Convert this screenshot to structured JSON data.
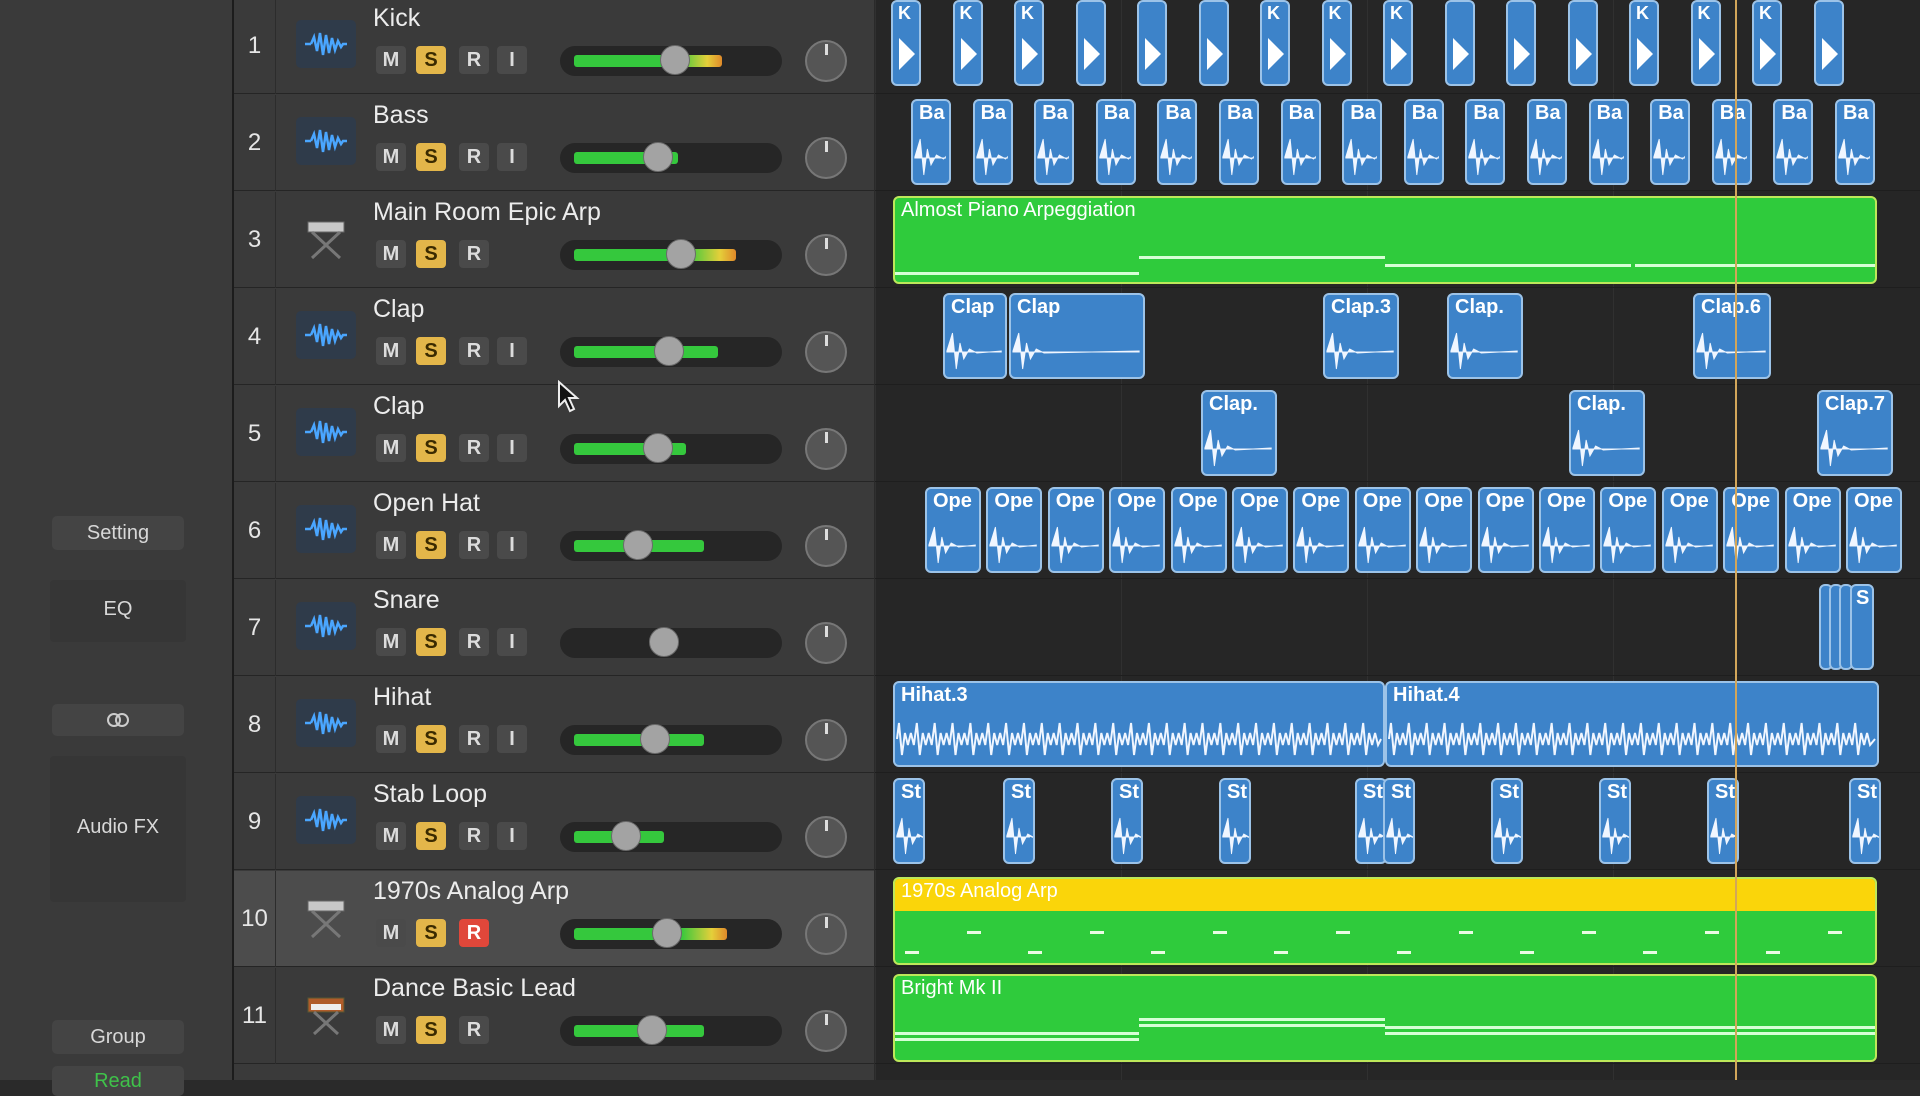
{
  "inspector": {
    "setting_label": "Setting",
    "eq_label": "EQ",
    "link_icon": "link-icon",
    "audio_fx_label": "Audio FX",
    "group_label": "Group",
    "read_label": "Read"
  },
  "track_buttons": {
    "mute": "M",
    "solo": "S",
    "record": "R",
    "input": "I"
  },
  "tracks": [
    {
      "num": "1",
      "name": "Kick",
      "type": "audio",
      "fader_level": 0.52,
      "meter": 0.82,
      "has_input": true
    },
    {
      "num": "2",
      "name": "Bass",
      "type": "audio",
      "fader_level": 0.42,
      "meter": 0.58,
      "has_input": true
    },
    {
      "num": "3",
      "name": "Main Room Epic Arp",
      "type": "instrument",
      "fader_level": 0.55,
      "meter": 0.9,
      "has_input": false
    },
    {
      "num": "4",
      "name": "Clap",
      "type": "audio",
      "fader_level": 0.48,
      "meter": 0.8,
      "has_input": true
    },
    {
      "num": "5",
      "name": "Clap",
      "type": "audio",
      "fader_level": 0.42,
      "meter": 0.62,
      "has_input": true
    },
    {
      "num": "6",
      "name": "Open Hat",
      "type": "audio",
      "fader_level": 0.3,
      "meter": 0.72,
      "has_input": true
    },
    {
      "num": "7",
      "name": "Snare",
      "type": "audio",
      "fader_level": 0.45,
      "meter": 0.0,
      "has_input": true
    },
    {
      "num": "8",
      "name": "Hihat",
      "type": "audio",
      "fader_level": 0.4,
      "meter": 0.72,
      "has_input": true
    },
    {
      "num": "9",
      "name": "Stab Loop",
      "type": "audio",
      "fader_level": 0.23,
      "meter": 0.5,
      "has_input": true
    },
    {
      "num": "10",
      "name": "1970s Analog Arp",
      "type": "instrument",
      "fader_level": 0.47,
      "meter": 0.85,
      "has_input": false,
      "selected": true,
      "record_armed": true
    },
    {
      "num": "11",
      "name": "Dance Basic Lead",
      "type": "keyboard",
      "fader_level": 0.38,
      "meter": 0.72,
      "has_input": false
    }
  ],
  "regions": {
    "kick_label": "K",
    "bass_label": "Ba",
    "arp_name": "Almost Piano Arpeggiation",
    "clap_a": [
      "Clap",
      "Clap",
      "Clap.3",
      "Clap.",
      "Clap.6"
    ],
    "clap_b": [
      "Clap.",
      "Clap.",
      "Clap.7"
    ],
    "open_hat_label": "Ope",
    "snare_label": "S",
    "hihat": [
      "Hihat.3",
      "Hihat.4"
    ],
    "stab_label": "St",
    "analog_arp_name": "1970s Analog Arp",
    "lead_name": "Bright Mk II"
  },
  "colors": {
    "audio_region": "#3d83c9",
    "midi_region": "#2fcb3c",
    "selected_header": "#fad50a",
    "solo": "#e3b64a",
    "record_armed": "#e0473a"
  }
}
